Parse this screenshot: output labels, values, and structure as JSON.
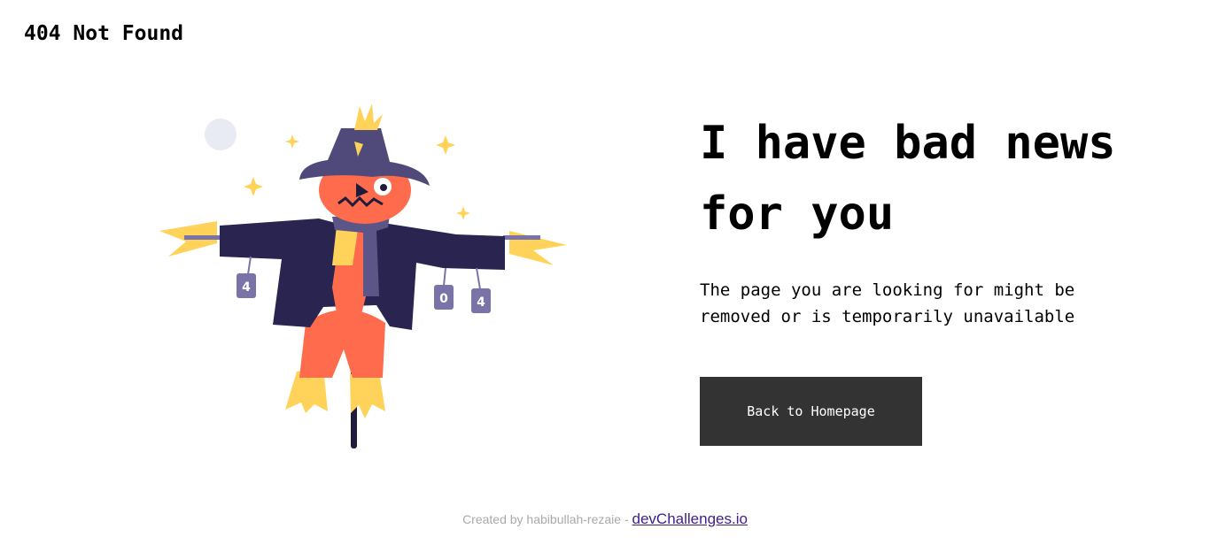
{
  "header": {
    "title": "404 Not Found"
  },
  "hero": {
    "headline": "I have bad news for you",
    "description": "The page you are looking for might be removed or is temporarily unavailable",
    "button_label": "Back to Homepage"
  },
  "illustration": {
    "can_labels": [
      "4",
      "0",
      "4"
    ],
    "colors": {
      "coat": "#2a2450",
      "hat": "#4f4a7a",
      "face": "#ff6b4d",
      "straw": "#ffd35a",
      "scarf": "#5c5588",
      "can": "#7a73a8",
      "moon": "#e8eaf4",
      "pole": "#1f1b3a"
    }
  },
  "footer": {
    "credit_text": "Created by habibullah-rezaie - ",
    "link_label": "devChallenges.io"
  },
  "colors": {
    "button_bg": "#333333",
    "button_text": "#ffffff",
    "text": "#000000",
    "footer_text": "#a9a9a9",
    "footer_link": "#3f1d8a"
  }
}
